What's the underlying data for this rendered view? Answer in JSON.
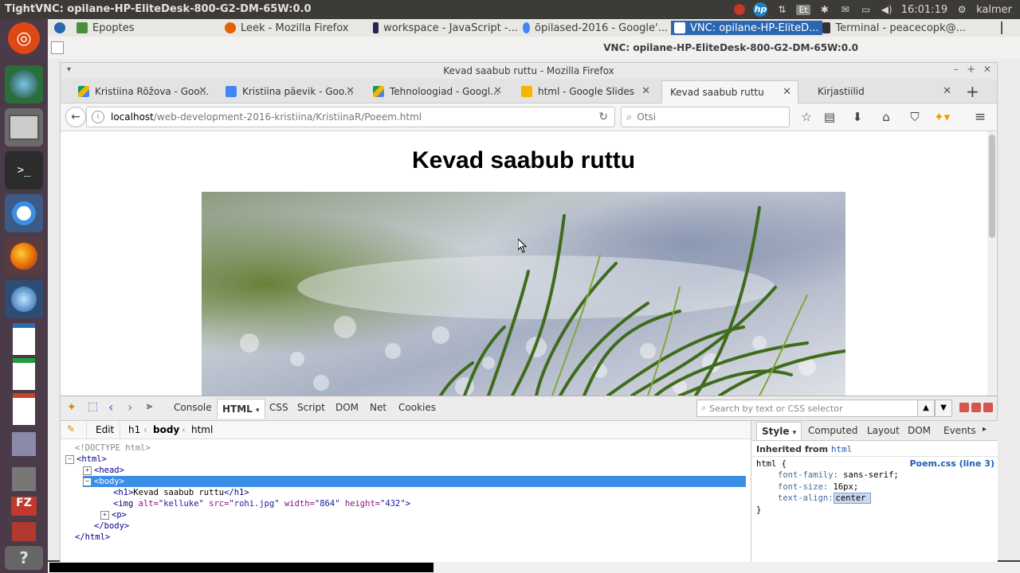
{
  "topbar": {
    "title": "TightVNC: opilane-HP-EliteDesk-800-G2-DM-65W:0.0",
    "keyboard": "Et",
    "clock": "16:01:19",
    "user": "kalmer"
  },
  "panel": {
    "tasks": [
      {
        "label": "Epoptes",
        "color": "#4a8f3c",
        "active": false
      },
      {
        "label": "Leek - Mozilla Firefox",
        "color": "#e66000",
        "active": false
      },
      {
        "label": "workspace - JavaScript -...",
        "color": "#2c2255",
        "active": false
      },
      {
        "label": "õpilased-2016 - Google'...",
        "color": "#4285f4",
        "active": false
      },
      {
        "label": "VNC: opilane-HP-EliteD...",
        "color": "#ffffff",
        "active": true
      },
      {
        "label": "Terminal - peacecopk@...",
        "color": "#333333",
        "active": false
      }
    ]
  },
  "vnc": {
    "title": "VNC: opilane-HP-EliteDesk-800-G2-DM-65W:0.0"
  },
  "firefox": {
    "window_title": "Kevad saabub ruttu - Mozilla Firefox",
    "tabs": [
      {
        "label": "Kristiina Rõžova - Goo...",
        "icon_color": "#0f9d58"
      },
      {
        "label": "Kristiina päevik - Goo...",
        "icon_color": "#4285f4"
      },
      {
        "label": "Tehnoloogiad - Googl...",
        "icon_color": "#0f9d58"
      },
      {
        "label": "html - Google Slides",
        "icon_color": "#f4b400"
      },
      {
        "label": "Kevad saabub ruttu",
        "icon_color": ""
      },
      {
        "label": "Kirjastiilid",
        "icon_color": ""
      }
    ],
    "url_host": "localhost",
    "url_path": "/web-development-2016-kristiina/KristiinaR/Poeem.html",
    "search_placeholder": "Otsi"
  },
  "page": {
    "heading": "Kevad saabub ruttu",
    "image_alt": "kelluke"
  },
  "firebug": {
    "tabs": [
      "Console",
      "HTML",
      "CSS",
      "Script",
      "DOM",
      "Net",
      "Cookies"
    ],
    "active_tab": "HTML",
    "search_placeholder": "Search by text or CSS selector",
    "edit_label": "Edit",
    "breadcrumb": [
      "h1",
      "body",
      "html"
    ],
    "side_tabs": [
      "Style",
      "Computed",
      "Layout",
      "DOM",
      "Events"
    ],
    "inherited_label": "Inherited from",
    "inherited_from": "html",
    "rule_source": "Poem.css (line 3)",
    "tree": {
      "doctype": "<!DOCTYPE html>",
      "html_open": "<html>",
      "head": "<head>",
      "body_open": "<body>",
      "h1_open": "<h1>",
      "h1_text": "Kevad saabub ruttu",
      "h1_close": "</h1>",
      "img_tag": "<img",
      "img_alt_name": " alt=",
      "img_alt_val": "\"kelluke\"",
      "img_src_name": " src=",
      "img_src_val": "\"rohi.jpg\"",
      "img_w_name": " width=",
      "img_w_val": "\"864\"",
      "img_h_name": " height=",
      "img_h_val": "\"432\"",
      "img_end": ">",
      "p": "<p>",
      "body_close": "</body>",
      "html_close": "</html>"
    },
    "css": {
      "selector": "html {",
      "p1_name": "font-family:",
      "p1_val": " sans-serif;",
      "p2_name": "font-size:",
      "p2_val": " 16px;",
      "p3_name": "text-align:",
      "p3_val": "center",
      "close": "}"
    }
  }
}
